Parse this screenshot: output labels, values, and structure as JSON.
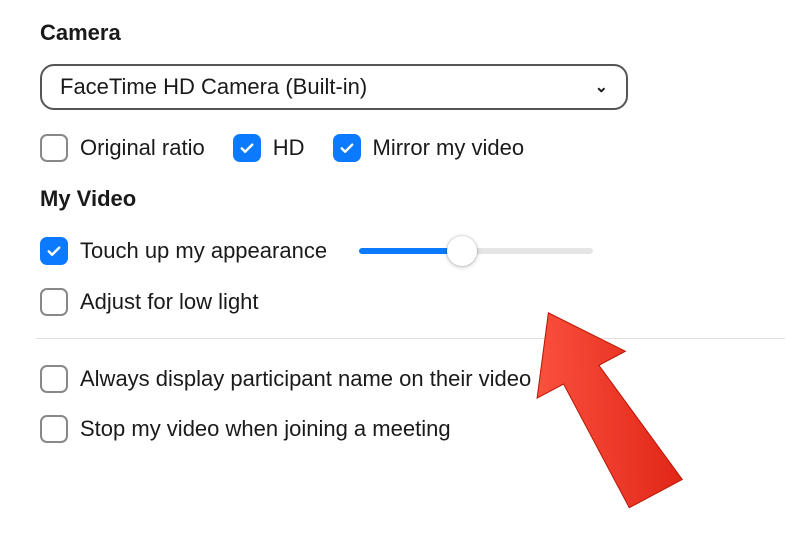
{
  "camera": {
    "section_label": "Camera",
    "dropdown_value": "FaceTime HD Camera (Built-in)"
  },
  "camera_opts": {
    "original_ratio": {
      "label": "Original ratio",
      "checked": false
    },
    "hd": {
      "label": "HD",
      "checked": true
    },
    "mirror": {
      "label": "Mirror my video",
      "checked": true
    }
  },
  "my_video": {
    "section_label": "My Video",
    "touch_up": {
      "label": "Touch up my appearance",
      "checked": true,
      "slider_percent": 44
    },
    "low_light": {
      "label": "Adjust for low light",
      "checked": false
    }
  },
  "extra": {
    "show_name": {
      "label": "Always display participant name on their video",
      "checked": false
    },
    "stop_on_join": {
      "label": "Stop my video when joining a meeting",
      "checked": false
    }
  },
  "colors": {
    "accent": "#0b7aff",
    "arrow": "#ff3b30"
  }
}
